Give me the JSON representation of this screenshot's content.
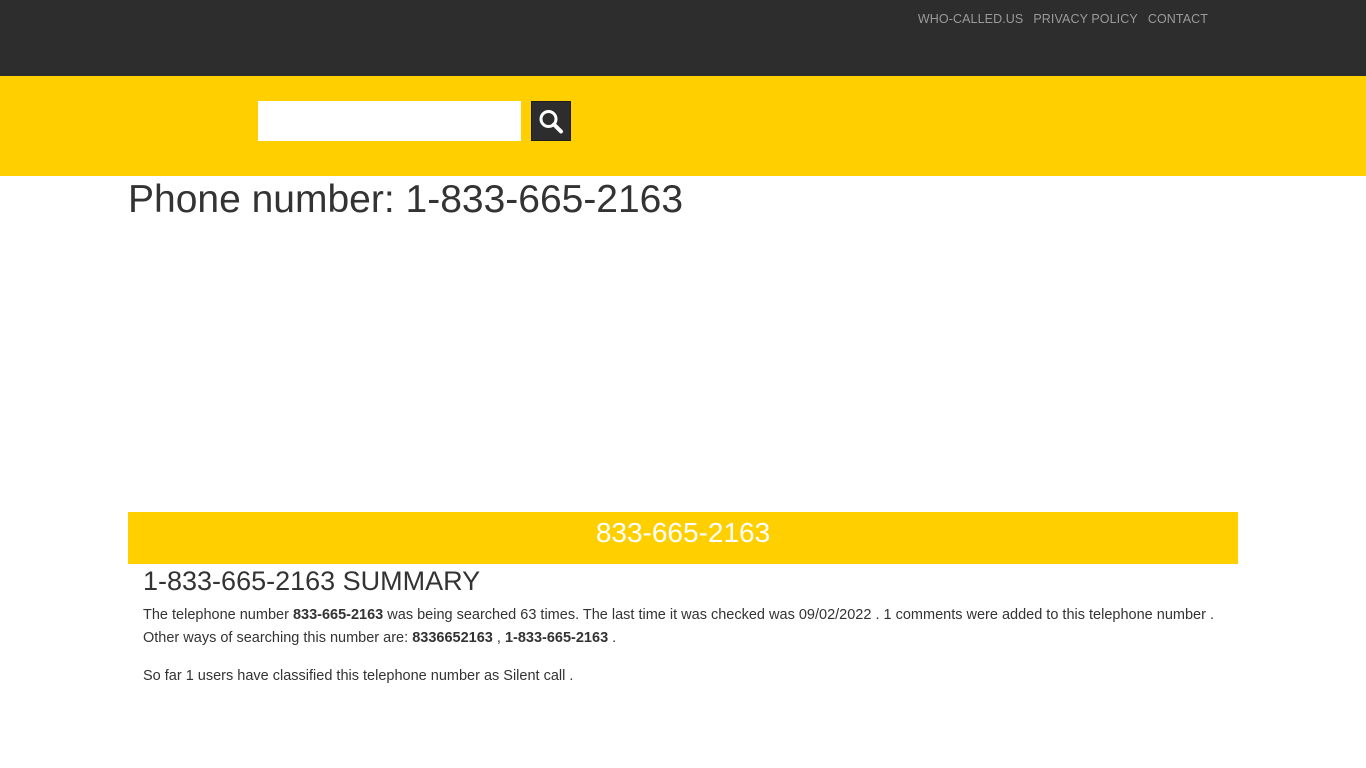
{
  "nav": {
    "items": [
      {
        "label": "WHO-CALLED.US"
      },
      {
        "label": "PRIVACY POLICY"
      },
      {
        "label": "CONTACT"
      }
    ]
  },
  "search": {
    "value": "",
    "placeholder": ""
  },
  "page": {
    "title": "Phone number: 1-833-665-2163",
    "banner_number": "833-665-2163"
  },
  "summary": {
    "heading": "1-833-665-2163 SUMMARY",
    "p1_a": "The telephone number ",
    "p1_number": "833-665-2163",
    "p1_b": " was being searched 63 times. The last time it was checked was 09/02/2022 . 1 comments were added to this telephone number . Other ways of searching this number are: ",
    "p1_alt1": "8336652163",
    "p1_sep": " , ",
    "p1_alt2": "1-833-665-2163",
    "p1_end": " .",
    "p2": "So far 1 users have classified this telephone number as Silent call ."
  },
  "colors": {
    "topbar": "#2d2d2d",
    "accent": "#ffcf00",
    "text": "#333333",
    "nav_text": "#9a9a9a"
  },
  "icons": {
    "search_button": "search-icon"
  }
}
